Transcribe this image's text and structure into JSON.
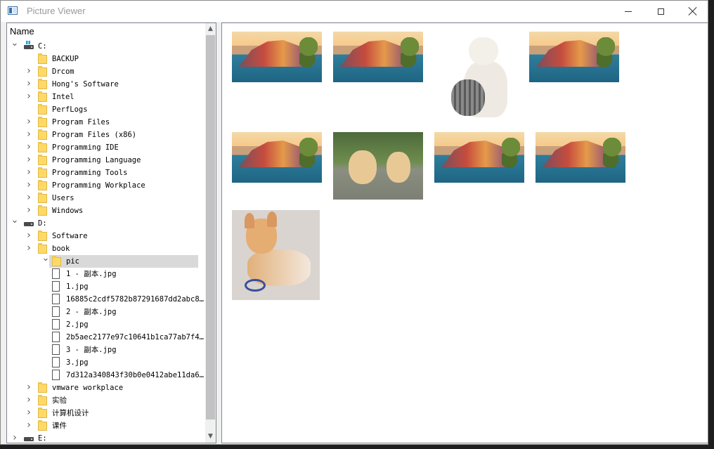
{
  "window": {
    "title": "Picture Viewer"
  },
  "tree": {
    "header": "Name",
    "rows": [
      {
        "depth": 0,
        "type": "drive",
        "icon": "windows-drive-icon",
        "label": "C:",
        "chevron": "expanded"
      },
      {
        "depth": 1,
        "type": "folder",
        "icon": "folder-icon",
        "label": "BACKUP",
        "chevron": "none"
      },
      {
        "depth": 1,
        "type": "folder",
        "icon": "folder-icon",
        "label": "Drcom",
        "chevron": "collapsed"
      },
      {
        "depth": 1,
        "type": "folder",
        "icon": "folder-icon",
        "label": "Hong's Software",
        "chevron": "collapsed"
      },
      {
        "depth": 1,
        "type": "folder",
        "icon": "folder-icon",
        "label": "Intel",
        "chevron": "collapsed"
      },
      {
        "depth": 1,
        "type": "folder",
        "icon": "folder-icon",
        "label": "PerfLogs",
        "chevron": "none"
      },
      {
        "depth": 1,
        "type": "folder",
        "icon": "folder-icon",
        "label": "Program Files",
        "chevron": "collapsed"
      },
      {
        "depth": 1,
        "type": "folder",
        "icon": "folder-icon",
        "label": "Program Files (x86)",
        "chevron": "collapsed"
      },
      {
        "depth": 1,
        "type": "folder",
        "icon": "folder-icon",
        "label": "Programming IDE",
        "chevron": "collapsed"
      },
      {
        "depth": 1,
        "type": "folder",
        "icon": "folder-icon",
        "label": "Programming Language",
        "chevron": "collapsed"
      },
      {
        "depth": 1,
        "type": "folder",
        "icon": "folder-icon",
        "label": "Programming Tools",
        "chevron": "collapsed"
      },
      {
        "depth": 1,
        "type": "folder",
        "icon": "folder-icon",
        "label": "Programming Workplace",
        "chevron": "collapsed"
      },
      {
        "depth": 1,
        "type": "folder",
        "icon": "folder-icon",
        "label": "Users",
        "chevron": "collapsed"
      },
      {
        "depth": 1,
        "type": "folder",
        "icon": "folder-icon",
        "label": "Windows",
        "chevron": "collapsed"
      },
      {
        "depth": 0,
        "type": "drive",
        "icon": "drive-icon",
        "label": "D:",
        "chevron": "expanded"
      },
      {
        "depth": 1,
        "type": "folder",
        "icon": "folder-icon",
        "label": "Software",
        "chevron": "collapsed"
      },
      {
        "depth": 1,
        "type": "folder",
        "icon": "folder-icon",
        "label": "book",
        "chevron": "collapsed"
      },
      {
        "depth": 1,
        "type": "folder",
        "icon": "folder-icon",
        "label": "pic",
        "chevron": "expanded",
        "selected": true
      },
      {
        "depth": 2,
        "type": "file",
        "icon": "file-icon",
        "label": "1 - 副本.jpg",
        "chevron": "none"
      },
      {
        "depth": 2,
        "type": "file",
        "icon": "file-icon",
        "label": "1.jpg",
        "chevron": "none"
      },
      {
        "depth": 2,
        "type": "file",
        "icon": "file-icon",
        "label": "16885c2cdf5782b87291687dd2abc8…",
        "chevron": "none"
      },
      {
        "depth": 2,
        "type": "file",
        "icon": "file-icon",
        "label": "2 - 副本.jpg",
        "chevron": "none"
      },
      {
        "depth": 2,
        "type": "file",
        "icon": "file-icon",
        "label": "2.jpg",
        "chevron": "none"
      },
      {
        "depth": 2,
        "type": "file",
        "icon": "file-icon",
        "label": "2b5aec2177e97c10641b1ca77ab7f4…",
        "chevron": "none"
      },
      {
        "depth": 2,
        "type": "file",
        "icon": "file-icon",
        "label": "3 - 副本.jpg",
        "chevron": "none"
      },
      {
        "depth": 2,
        "type": "file",
        "icon": "file-icon",
        "label": "3.jpg",
        "chevron": "none"
      },
      {
        "depth": 2,
        "type": "file",
        "icon": "file-icon",
        "label": "7d312a340843f30b0e0412abe11da6…",
        "chevron": "none"
      },
      {
        "depth": 1,
        "type": "folder",
        "icon": "folder-icon",
        "label": "vmware workplace",
        "chevron": "collapsed"
      },
      {
        "depth": 1,
        "type": "folder",
        "icon": "folder-icon",
        "label": "实验",
        "chevron": "collapsed"
      },
      {
        "depth": 1,
        "type": "folder",
        "icon": "folder-icon",
        "label": "计算机设计",
        "chevron": "collapsed"
      },
      {
        "depth": 1,
        "type": "folder",
        "icon": "folder-icon",
        "label": "课件",
        "chevron": "collapsed"
      },
      {
        "depth": 0,
        "type": "drive",
        "icon": "drive-icon",
        "label": "E:",
        "chevron": "collapsed"
      }
    ]
  },
  "pictures": [
    {
      "kind": "landscape"
    },
    {
      "kind": "landscape"
    },
    {
      "kind": "dog-and-cat"
    },
    {
      "kind": "landscape"
    },
    {
      "kind": "landscape"
    },
    {
      "kind": "puppies"
    },
    {
      "kind": "landscape"
    },
    {
      "kind": "landscape"
    },
    {
      "kind": "corgi"
    }
  ],
  "colors": {
    "selection": "#d9d9d9",
    "folder": "#ffd966",
    "scrollbar_thumb": "#c2c2c2"
  }
}
